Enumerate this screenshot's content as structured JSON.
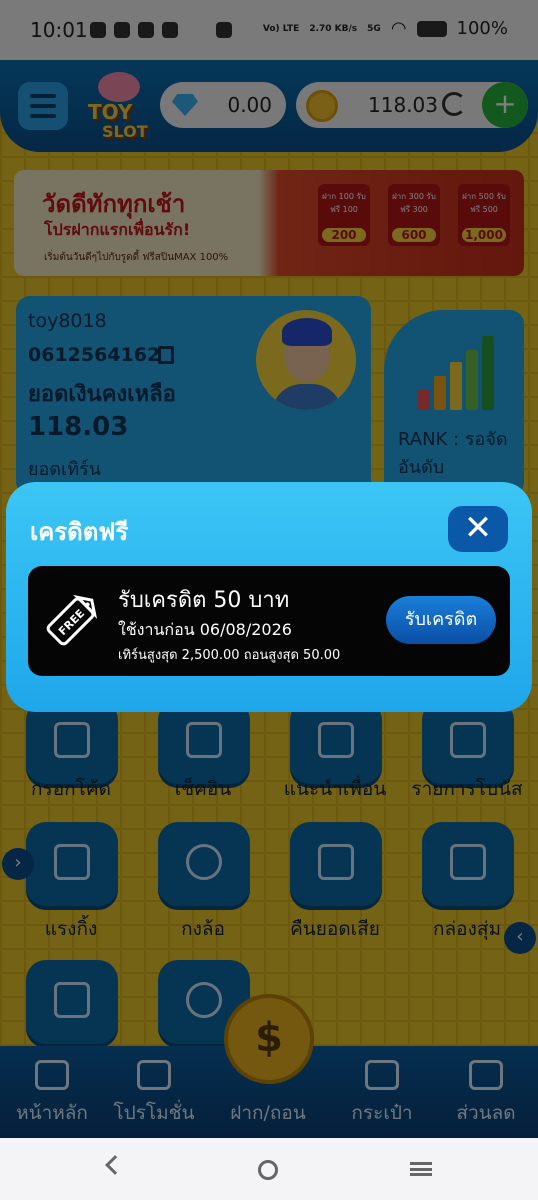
{
  "status": {
    "time": "10:01",
    "net": "Vo) LTE",
    "speed": "2.70 KB/s",
    "signal": "5G",
    "battery": "100%"
  },
  "header": {
    "logo_line1": "TOY",
    "logo_line2": "SLOT",
    "gems": "0.00",
    "coins": "118.03",
    "plus": "+"
  },
  "banner": {
    "headline": "วัดดีทักทุกเช้า",
    "subline": "โปรฝากแรกเพื่อนรัก!",
    "small": "เริ่มต้นวันดีๆไปกับรูดดี้ ฟรีสปินMAX 100%",
    "promos": [
      {
        "label": "ฝาก 100 รับฟรี 100",
        "value": "200"
      },
      {
        "label": "ฝาก 300 รับฟรี 300",
        "value": "600"
      },
      {
        "label": "ฝาก 500 รับฟรี 500",
        "value": "1,000"
      }
    ]
  },
  "user": {
    "username": "toy8018",
    "phone": "0612564162",
    "balance_label": "ยอดเงินคงเหลือ",
    "balance": "118.03",
    "turnover_label": "ยอดเทิร์น",
    "rank_label": "RANK : รอจัด",
    "rank_label2": "อันดับ"
  },
  "menu": {
    "row1": [
      "กรอกโค้ด",
      "เช็คอิน",
      "แนะนำเพื่อน",
      "รายการโบนัส"
    ],
    "row2": [
      "แรงกิ้ง",
      "กงล้อ",
      "คืนยอดเสีย",
      "กล่องสุ่ม"
    ]
  },
  "bottom_nav": {
    "home": "หน้าหลัก",
    "promotion": "โปรโมชั่น",
    "deposit": "ฝาก/ถอน",
    "wallet": "กระเป๋า",
    "discount": "ส่วนลด",
    "center": "$"
  },
  "modal": {
    "title": "เครดิตฟรี",
    "close": "✕",
    "credit_title": "รับเครดิต 50 บาท",
    "expiry": "ใช้งานก่อน 06/08/2026",
    "limits": "เทิร์นสูงสุด 2,500.00 ถอนสูงสุด 50.00",
    "claim_button": "รับเครดิต",
    "free_tag": "FREE"
  },
  "colors": {
    "modal_bg": "#1ea6ea",
    "claim_btn": "#0b4fa6",
    "panel_blue": "#25a7e6"
  }
}
